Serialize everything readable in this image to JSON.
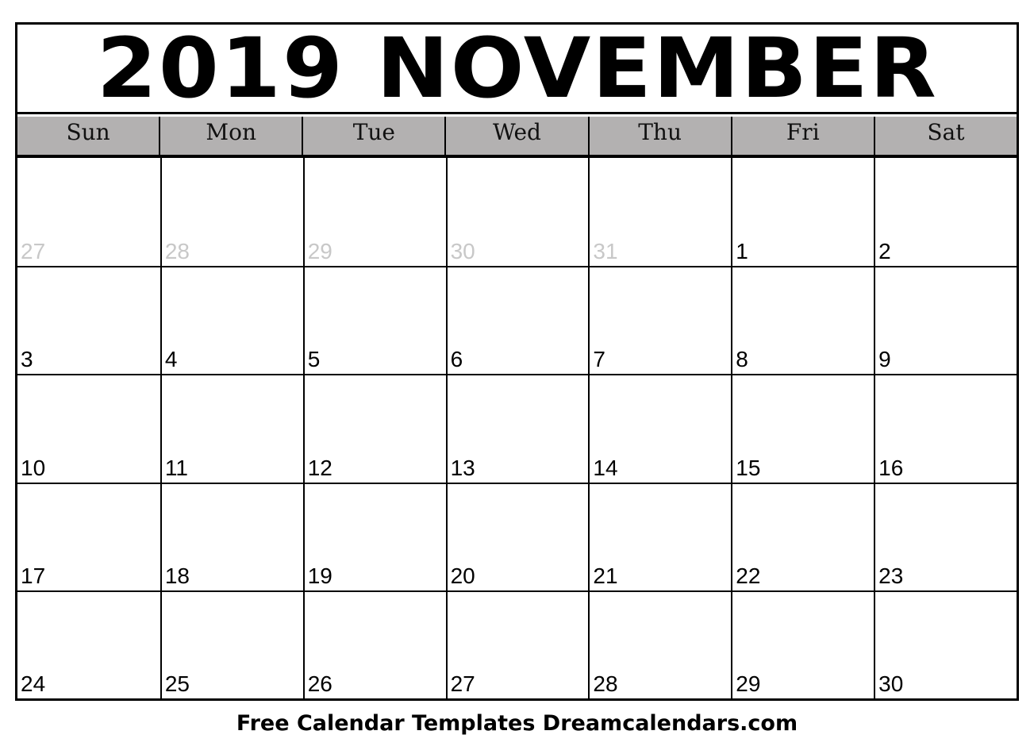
{
  "title": "2019 NOVEMBER",
  "weekdays": [
    "Sun",
    "Mon",
    "Tue",
    "Wed",
    "Thu",
    "Fri",
    "Sat"
  ],
  "weeks": [
    [
      {
        "d": "27",
        "other": true
      },
      {
        "d": "28",
        "other": true
      },
      {
        "d": "29",
        "other": true
      },
      {
        "d": "30",
        "other": true
      },
      {
        "d": "31",
        "other": true
      },
      {
        "d": "1"
      },
      {
        "d": "2"
      }
    ],
    [
      {
        "d": "3"
      },
      {
        "d": "4"
      },
      {
        "d": "5"
      },
      {
        "d": "6"
      },
      {
        "d": "7"
      },
      {
        "d": "8"
      },
      {
        "d": "9"
      }
    ],
    [
      {
        "d": "10"
      },
      {
        "d": "11"
      },
      {
        "d": "12"
      },
      {
        "d": "13"
      },
      {
        "d": "14"
      },
      {
        "d": "15"
      },
      {
        "d": "16"
      }
    ],
    [
      {
        "d": "17"
      },
      {
        "d": "18"
      },
      {
        "d": "19"
      },
      {
        "d": "20"
      },
      {
        "d": "21"
      },
      {
        "d": "22"
      },
      {
        "d": "23"
      }
    ],
    [
      {
        "d": "24"
      },
      {
        "d": "25"
      },
      {
        "d": "26"
      },
      {
        "d": "27"
      },
      {
        "d": "28"
      },
      {
        "d": "29"
      },
      {
        "d": "30"
      }
    ]
  ],
  "footer": "Free Calendar Templates Dreamcalendars.com",
  "colors": {
    "header_bg": "#b3b1b1",
    "other_month_text": "#c8c8c8"
  }
}
